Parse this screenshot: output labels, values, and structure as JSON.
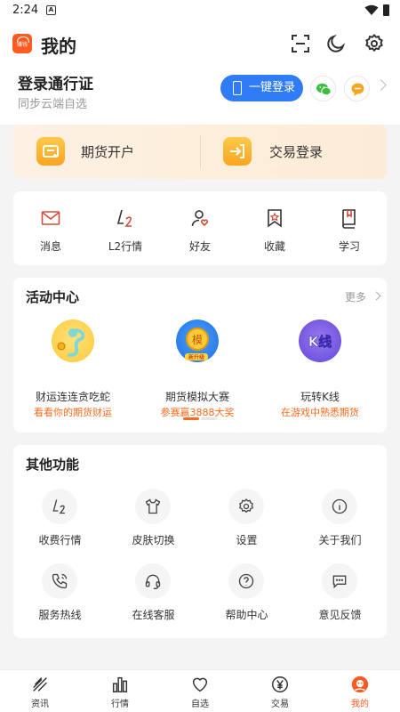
{
  "status_bar": {
    "time": "2:24"
  },
  "header": {
    "logo_text": "赚钱",
    "title": "我的"
  },
  "login": {
    "title": "登录通行证",
    "subtitle": "同步云端自选",
    "one_key_label": "一键登录"
  },
  "trade": {
    "open_account": "期货开户",
    "trade_login": "交易登录"
  },
  "quick_entries": [
    {
      "label": "消息",
      "icon": "mail-icon"
    },
    {
      "label": "L2行情",
      "icon": "l2-icon"
    },
    {
      "label": "好友",
      "icon": "friend-icon"
    },
    {
      "label": "收藏",
      "icon": "bookmark-icon"
    },
    {
      "label": "学习",
      "icon": "book-icon"
    }
  ],
  "activity": {
    "title": "活动中心",
    "more": "更多",
    "items": [
      {
        "name": "财运连连贪吃蛇",
        "sub": "看看你的期货财运",
        "badge": ""
      },
      {
        "name": "期货模拟大赛",
        "sub": "参赛赢3888大奖",
        "badge": "模",
        "tag": "新升级"
      },
      {
        "name": "玩转K线",
        "sub": "在游戏中熟悉期货",
        "badge": "K线"
      }
    ]
  },
  "other": {
    "title": "其他功能",
    "items": [
      {
        "label": "收费行情",
        "icon": "l2-icon"
      },
      {
        "label": "皮肤切换",
        "icon": "shirt-icon"
      },
      {
        "label": "设置",
        "icon": "gear-icon"
      },
      {
        "label": "关于我们",
        "icon": "info-icon"
      },
      {
        "label": "服务热线",
        "icon": "phone-icon"
      },
      {
        "label": "在线客服",
        "icon": "headset-icon"
      },
      {
        "label": "帮助中心",
        "icon": "help-icon"
      },
      {
        "label": "意见反馈",
        "icon": "feedback-icon"
      }
    ]
  },
  "tabs": [
    {
      "label": "资讯"
    },
    {
      "label": "行情"
    },
    {
      "label": "自选"
    },
    {
      "label": "交易"
    },
    {
      "label": "我的"
    }
  ],
  "colors": {
    "accent": "#ff5a1f",
    "login_blue": "#2f7cf6",
    "trade_gold": "#f9a521"
  }
}
